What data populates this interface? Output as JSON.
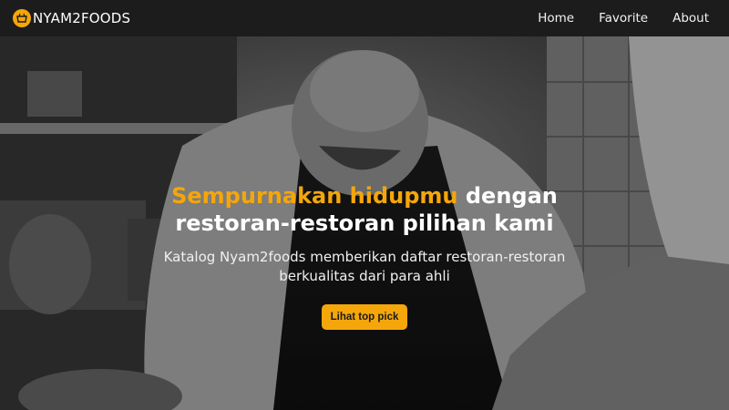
{
  "navbar": {
    "brand": "NYAM2FOODS",
    "logo_icon": "food-logo-icon",
    "links": [
      {
        "label": "Home"
      },
      {
        "label": "Favorite"
      },
      {
        "label": "About"
      }
    ]
  },
  "hero": {
    "title_highlight": "Sempurnakan hidupmu",
    "title_rest_line1": " dengan",
    "title_line2": "restoran-restoran pilihan kami",
    "subtitle_line1": "Katalog Nyam2foods memberikan daftar restoran-restoran",
    "subtitle_line2": "berkualitas dari para ahli",
    "cta_label": "Lihat top pick"
  },
  "colors": {
    "accent": "#f5a60a",
    "navbar_bg": "#1c1c1c",
    "text": "#ffffff"
  }
}
